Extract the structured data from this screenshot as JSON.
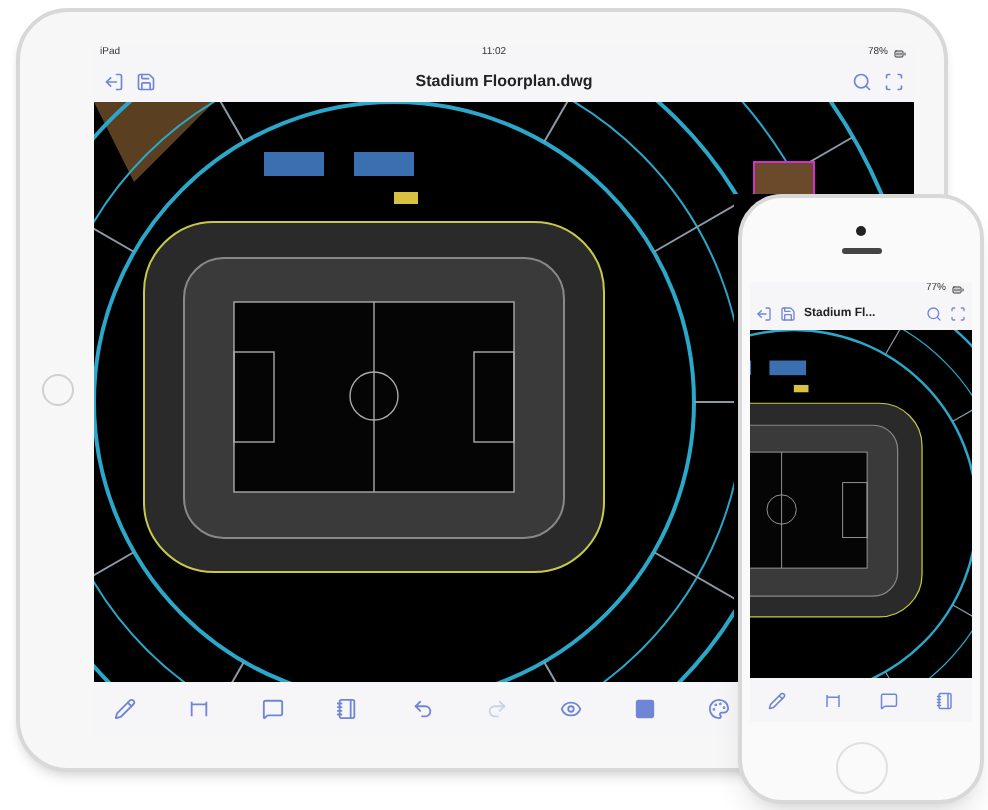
{
  "ipad": {
    "status_bar": {
      "carrier": "iPad",
      "time": "11:02",
      "battery": "78%"
    },
    "title": "Stadium Floorplan.dwg",
    "toolbar": [
      {
        "kind": "pencil",
        "disabled": false
      },
      {
        "kind": "dimension",
        "disabled": false
      },
      {
        "kind": "comment",
        "disabled": false
      },
      {
        "kind": "layers",
        "disabled": false
      },
      {
        "kind": "undo",
        "disabled": false
      },
      {
        "kind": "redo",
        "disabled": true
      },
      {
        "kind": "eye",
        "disabled": false
      },
      {
        "kind": "sheet",
        "disabled": false
      },
      {
        "kind": "palette",
        "disabled": false
      }
    ]
  },
  "iphone": {
    "status_bar": {
      "battery": "77%"
    },
    "title": "Stadium Fl...",
    "toolbar": [
      {
        "kind": "pencil",
        "disabled": false
      },
      {
        "kind": "dimension",
        "disabled": false
      },
      {
        "kind": "comment",
        "disabled": false
      },
      {
        "kind": "layers",
        "disabled": false
      }
    ]
  }
}
